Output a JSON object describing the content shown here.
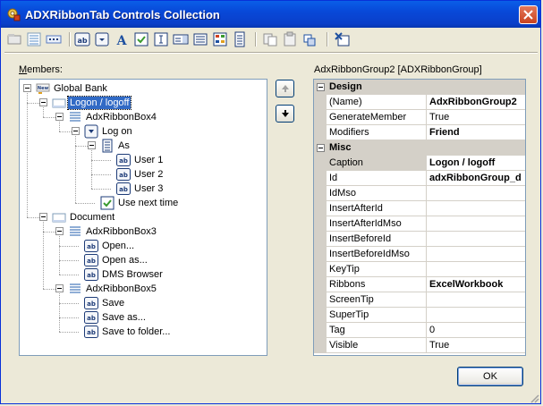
{
  "window": {
    "title": "ADXRibbonTab Controls Collection",
    "colors": {
      "titlebar": "#0848D8",
      "selection": "#316AC5",
      "close": "#C9431F",
      "check": "#3A9A2E"
    }
  },
  "toolbar": {
    "icons": [
      "tab-icon",
      "group-icon",
      "box-icon",
      "button-icon",
      "dropdown-icon",
      "label-icon",
      "checkbox-icon",
      "editbox-icon",
      "combobox-icon",
      "gallery-icon",
      "menu-icon",
      "splitbutton-icon",
      "separator-icon",
      "copy-icon",
      "paste-icon",
      "move-icon",
      "delete-icon"
    ]
  },
  "members": {
    "label_prefix": "",
    "label_underlined": "M",
    "label_rest": "embers:",
    "tree": [
      {
        "label": "Global Bank",
        "icon": "tab-icon",
        "selected": false
      },
      {
        "label": "Logon / logoff",
        "icon": "group-icon",
        "selected": true
      },
      {
        "label": "AdxRibbonBox4",
        "icon": "box-icon",
        "selected": false
      },
      {
        "label": "Log on",
        "icon": "dropdown-icon",
        "selected": false
      },
      {
        "label": "As",
        "icon": "menu-icon",
        "selected": false
      },
      {
        "label": "User 1",
        "icon": "button-icon",
        "selected": false
      },
      {
        "label": "User 2",
        "icon": "button-icon",
        "selected": false
      },
      {
        "label": "User 3",
        "icon": "button-icon",
        "selected": false
      },
      {
        "label": "Use next time",
        "icon": "checkbox-icon",
        "selected": false
      },
      {
        "label": "Document",
        "icon": "group-icon",
        "selected": false
      },
      {
        "label": "AdxRibbonBox3",
        "icon": "box-icon",
        "selected": false
      },
      {
        "label": "Open...",
        "icon": "button-icon",
        "selected": false
      },
      {
        "label": "Open as...",
        "icon": "button-icon",
        "selected": false
      },
      {
        "label": "DMS Browser",
        "icon": "button-icon",
        "selected": false
      },
      {
        "label": "AdxRibbonBox5",
        "icon": "box-icon",
        "selected": false
      },
      {
        "label": "Save",
        "icon": "button-icon",
        "selected": false
      },
      {
        "label": "Save as...",
        "icon": "button-icon",
        "selected": false
      },
      {
        "label": "Save to folder...",
        "icon": "button-icon",
        "selected": false
      }
    ],
    "tab_icon_text": "New",
    "ab_text": "ab"
  },
  "properties": {
    "header": "AdxRibbonGroup2 [ADXRibbonGroup]",
    "rows": [
      {
        "type": "category",
        "name": "Design"
      },
      {
        "type": "prop",
        "name": "(Name)",
        "value": "AdxRibbonGroup2",
        "bold": true
      },
      {
        "type": "prop",
        "name": "GenerateMember",
        "value": "True",
        "bold": false
      },
      {
        "type": "prop",
        "name": "Modifiers",
        "value": "Friend",
        "bold": true
      },
      {
        "type": "category",
        "name": "Misc"
      },
      {
        "type": "prop",
        "name": "Caption",
        "value": "Logon / logoff",
        "bold": true,
        "selected": true
      },
      {
        "type": "prop",
        "name": "Id",
        "value": "adxRibbonGroup_d",
        "bold": true
      },
      {
        "type": "prop",
        "name": "IdMso",
        "value": "",
        "bold": false
      },
      {
        "type": "prop",
        "name": "InsertAfterId",
        "value": "",
        "bold": false
      },
      {
        "type": "prop",
        "name": "InsertAfterIdMso",
        "value": "",
        "bold": false
      },
      {
        "type": "prop",
        "name": "InsertBeforeId",
        "value": "",
        "bold": false
      },
      {
        "type": "prop",
        "name": "InsertBeforeIdMso",
        "value": "",
        "bold": false
      },
      {
        "type": "prop",
        "name": "KeyTip",
        "value": "",
        "bold": false
      },
      {
        "type": "prop",
        "name": "Ribbons",
        "value": "ExcelWorkbook",
        "bold": true
      },
      {
        "type": "prop",
        "name": "ScreenTip",
        "value": "",
        "bold": false
      },
      {
        "type": "prop",
        "name": "SuperTip",
        "value": "",
        "bold": false
      },
      {
        "type": "prop",
        "name": "Tag",
        "value": "0",
        "bold": false
      },
      {
        "type": "prop",
        "name": "Visible",
        "value": "True",
        "bold": false
      }
    ]
  },
  "footer": {
    "ok_label": "OK"
  }
}
